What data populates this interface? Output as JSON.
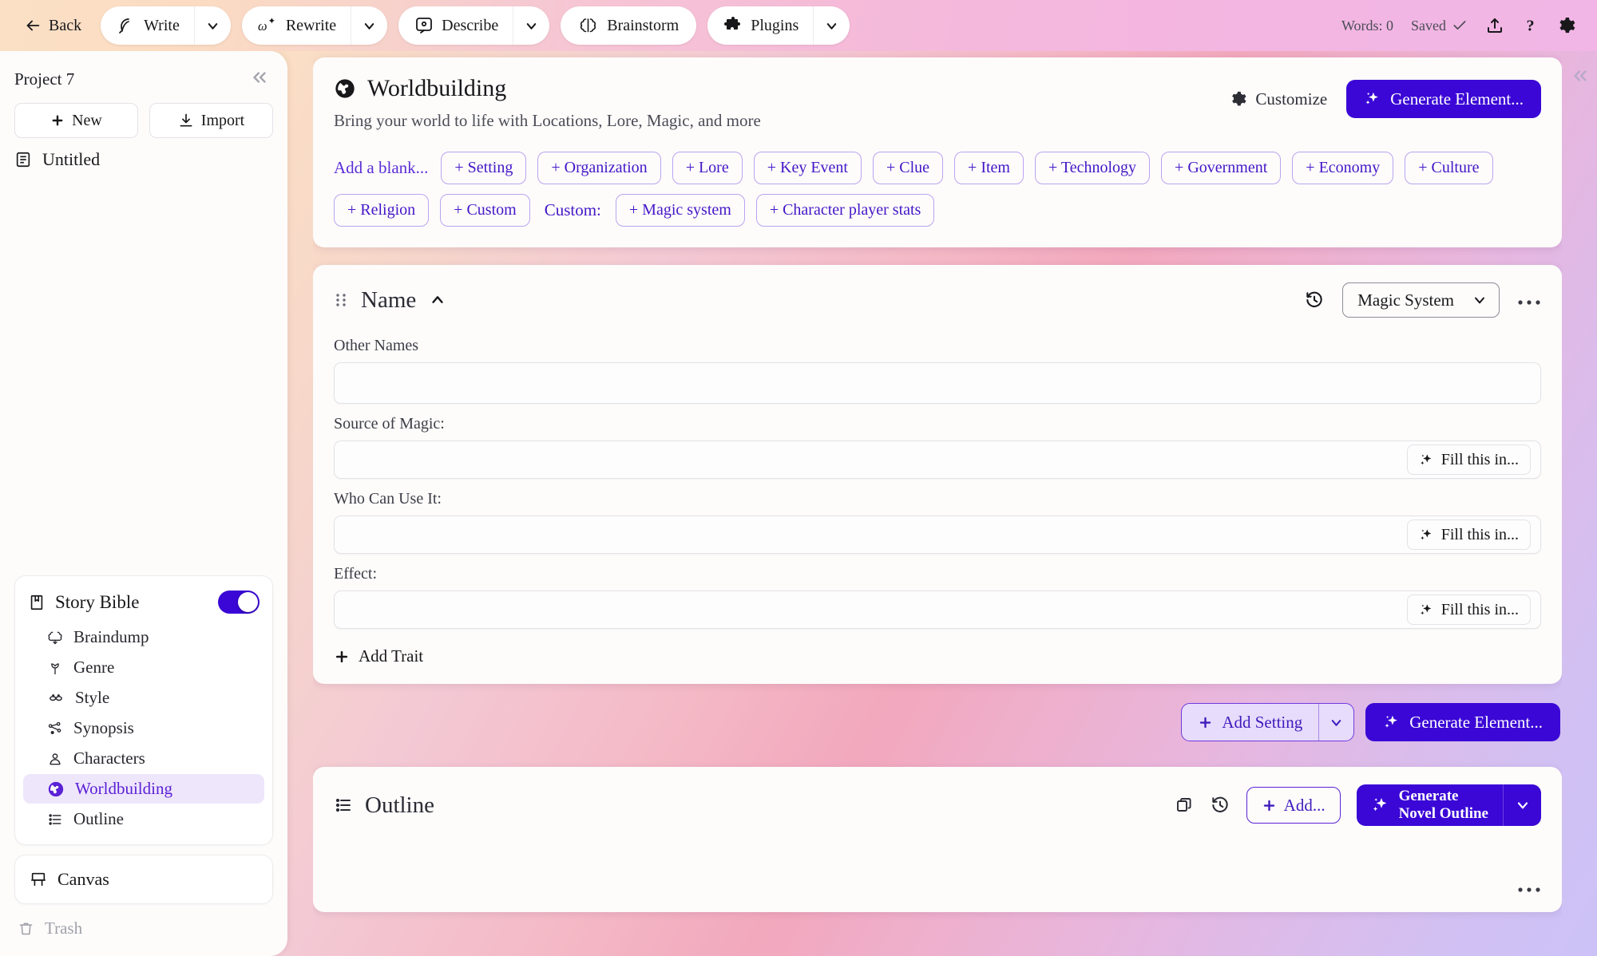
{
  "topbar": {
    "back": "Back",
    "tools": [
      {
        "label": "Write",
        "icon": "feather-pen-icon",
        "caret": true
      },
      {
        "label": "Rewrite",
        "icon": "rewrite-icon",
        "caret": true
      },
      {
        "label": "Describe",
        "icon": "describe-icon",
        "caret": true
      }
    ],
    "brainstorm": "Brainstorm",
    "plugins": "Plugins",
    "words": "Words: 0",
    "saved": "Saved",
    "share_icon": "share-upload-icon",
    "help_icon": "question-mark-icon",
    "settings_icon": "gear-icon"
  },
  "sidebar": {
    "project": "Project 7",
    "collapse_icon": "chevrons-left-icon",
    "new": "New",
    "import": "Import",
    "document": "Untitled",
    "story_bible": "Story Bible",
    "story_bible_toggle": "on",
    "items": [
      {
        "label": "Braindump",
        "icon": "brain-icon",
        "active": false
      },
      {
        "label": "Genre",
        "icon": "tulip-icon",
        "active": false
      },
      {
        "label": "Style",
        "icon": "mustache-icon",
        "active": false
      },
      {
        "label": "Synopsis",
        "icon": "nodes-icon",
        "active": false
      },
      {
        "label": "Characters",
        "icon": "person-icon",
        "active": false
      },
      {
        "label": "Worldbuilding",
        "icon": "globe-icon",
        "active": true
      },
      {
        "label": "Outline",
        "icon": "list-icon",
        "active": false
      }
    ],
    "canvas": "Canvas",
    "trash": "Trash"
  },
  "worldbuilding": {
    "title": "Worldbuilding",
    "icon": "globe-icon",
    "subtitle": "Bring your world to life with Locations, Lore, Magic, and more",
    "customize": "Customize",
    "generate": "Generate Element...",
    "add_blank_label": "Add a blank...",
    "chips": [
      "+ Setting",
      "+ Organization",
      "+ Lore",
      "+ Key Event",
      "+ Clue",
      "+ Item",
      "+ Technology",
      "+ Government",
      "+ Economy",
      "+ Culture",
      "+ Religion",
      "+ Custom"
    ],
    "custom_label": "Custom:",
    "custom_chips": [
      "+ Magic system",
      "+ Character player stats"
    ]
  },
  "element": {
    "name": "Name",
    "collapse_icon": "chevron-up-icon",
    "history_icon": "history-clock-icon",
    "type": "Magic System",
    "menu_icon": "ellipsis-icon",
    "fields": [
      {
        "label": "Other Names",
        "value": "",
        "fill": null
      },
      {
        "label": "Source of Magic:",
        "value": "",
        "fill": "Fill this in..."
      },
      {
        "label": "Who Can Use It:",
        "value": "",
        "fill": "Fill this in..."
      },
      {
        "label": "Effect:",
        "value": "",
        "fill": "Fill this in..."
      }
    ],
    "add_trait": "Add Trait"
  },
  "actions": {
    "add_setting": "Add Setting",
    "generate_element": "Generate Element..."
  },
  "outline": {
    "title": "Outline",
    "icon": "list-icon",
    "copy_icon": "copy-icon",
    "history_icon": "history-clock-icon",
    "add": "Add...",
    "generate_line1": "Generate",
    "generate_line2": "Novel Outline",
    "menu_icon": "ellipsis-icon"
  },
  "colors": {
    "accent": "#3a07d6",
    "chip_text": "#4416c7",
    "active_bg": "#eee6fb"
  }
}
